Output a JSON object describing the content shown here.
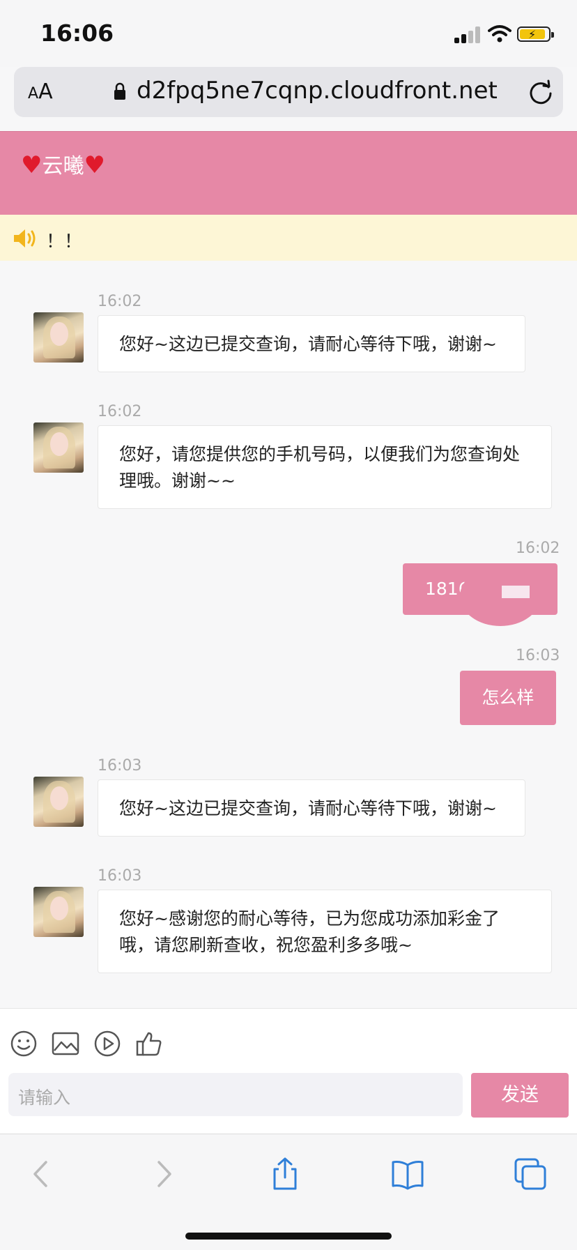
{
  "status": {
    "time": "16:06"
  },
  "browser": {
    "text_size_label_small": "A",
    "text_size_label_large": "A",
    "url": "d2fpq5ne7cqnp.cloudfront.net"
  },
  "chat": {
    "title": "云曦",
    "notice": "！！",
    "messages": [
      {
        "side": "left",
        "time": "16:02",
        "text": "您好~这边已提交查询，请耐心等待下哦，谢谢~"
      },
      {
        "side": "left",
        "time": "16:02",
        "text": "您好，请您提供您的手机号码，以便我们为您查询处理哦。谢谢~~"
      },
      {
        "side": "right",
        "time": "16:02",
        "text": "1816"
      },
      {
        "side": "right",
        "time": "16:03",
        "text": "怎么样"
      },
      {
        "side": "left",
        "time": "16:03",
        "text": "您好~这边已提交查询，请耐心等待下哦，谢谢~"
      },
      {
        "side": "left",
        "time": "16:03",
        "text": "您好~感谢您的耐心等待，已为您成功添加彩金了哦，请您刷新查收，祝您盈利多多哦~"
      }
    ]
  },
  "composer": {
    "placeholder": "请输入",
    "send_label": "发送"
  },
  "colors": {
    "brand_pink": "#e688a6",
    "notice_bg": "#fdf6d6",
    "heart": "#e01a2c"
  }
}
